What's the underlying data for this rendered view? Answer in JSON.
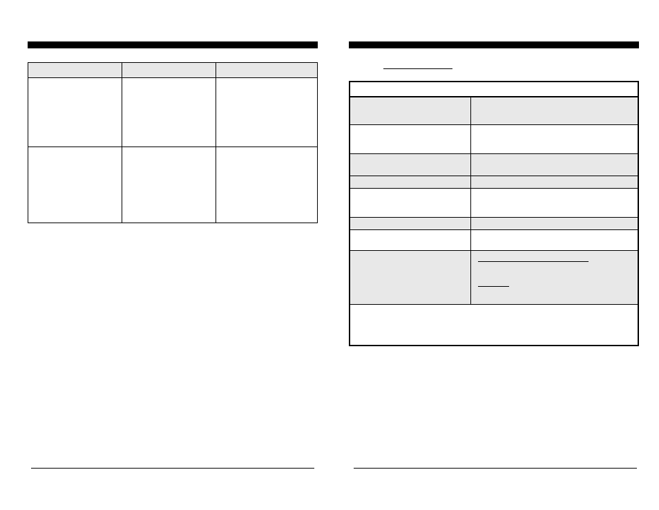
{
  "left": {
    "heading": "",
    "table": {
      "headers": [
        "",
        "",
        ""
      ],
      "rows": [
        {
          "c1": "",
          "c2": "",
          "c3": ""
        },
        {
          "c1": "",
          "c2": "",
          "c3": ""
        }
      ]
    },
    "footer": ""
  },
  "right": {
    "heading": "",
    "label_underlined": "",
    "rows": [
      {
        "c1": "",
        "c2": ""
      },
      {
        "c1": "",
        "c2": ""
      },
      {
        "c1": "",
        "c2": ""
      },
      {
        "c1": "",
        "c2": ""
      },
      {
        "c1": "",
        "c2": ""
      },
      {
        "c1": "",
        "c2": ""
      },
      {
        "c1": "",
        "c2": ""
      },
      {
        "c1": "",
        "c2_line1": "",
        "c2_line2": ""
      },
      {
        "merged": ""
      }
    ],
    "footer": ""
  }
}
